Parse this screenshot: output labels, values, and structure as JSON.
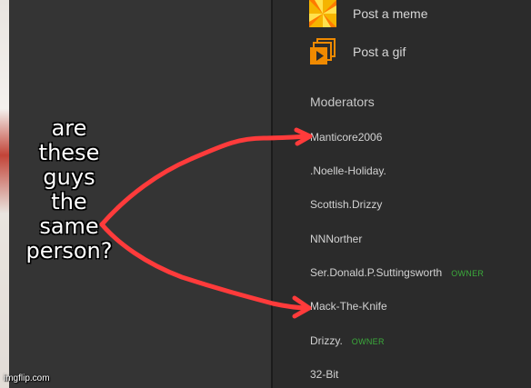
{
  "meme": {
    "caption_lines": [
      "are",
      "these",
      "guys",
      "the",
      "same",
      "person?"
    ],
    "watermark": "imgflip.com"
  },
  "actions": {
    "post_meme": {
      "label": "Post a meme",
      "icon": "meme-icon"
    },
    "post_gif": {
      "label": "Post a gif",
      "icon": "gif-icon"
    }
  },
  "moderators": {
    "heading": "Moderators",
    "list": [
      {
        "name": "Manticore2006",
        "badge": ""
      },
      {
        "name": ".Noelle-Holiday.",
        "badge": ""
      },
      {
        "name": "Scottish.Drizzy",
        "badge": ""
      },
      {
        "name": "NNNorther",
        "badge": ""
      },
      {
        "name": "Ser.Donald.P.Suttingsworth",
        "badge": "OWNER"
      },
      {
        "name": "Mack-The-Knife",
        "badge": ""
      },
      {
        "name": "Drizzy.",
        "badge": "OWNER"
      },
      {
        "name": "32-Bit",
        "badge": ""
      }
    ]
  },
  "colors": {
    "arrow": "#ff3b3b",
    "owner_badge": "#3bab3b",
    "background": "#2b2b2b"
  }
}
